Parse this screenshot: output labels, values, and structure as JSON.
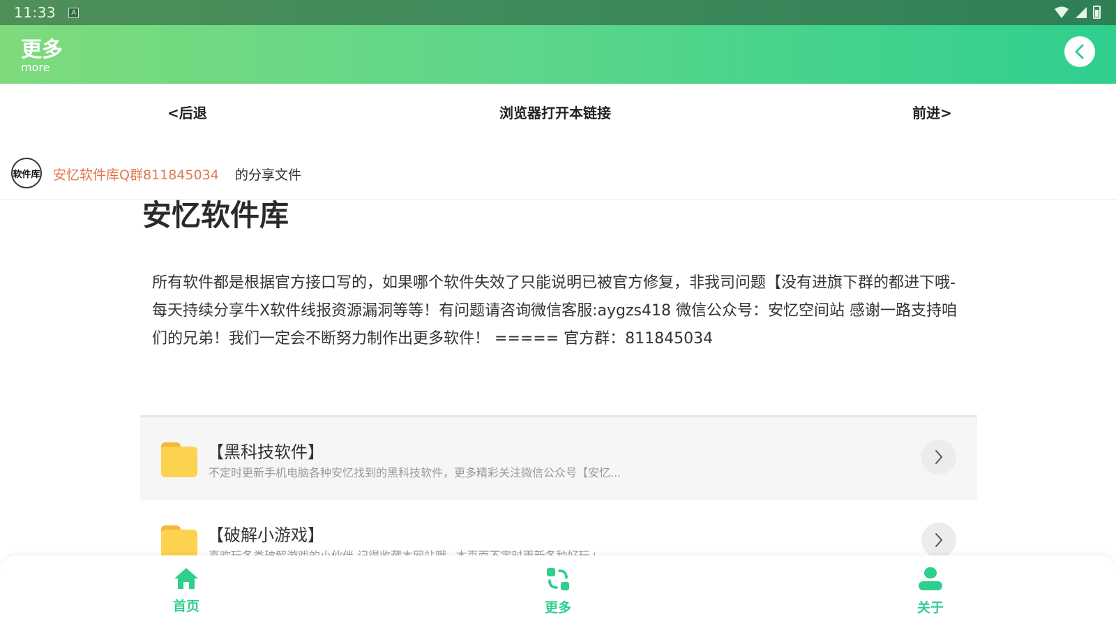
{
  "status_bar": {
    "time": "11:33",
    "keyboard_badge": "A"
  },
  "header": {
    "title": "更多",
    "subtitle": "more"
  },
  "nav": {
    "back": "<后退",
    "open_in_browser": "浏览器打开本链接",
    "forward": "前进>"
  },
  "share": {
    "avatar_text": "软件库",
    "name": "安忆软件库Q群811845034",
    "suffix": "的分享文件"
  },
  "content": {
    "title": "安忆软件库",
    "description": "所有软件都是根据官方接口写的，如果哪个软件失效了只能说明已被官方修复，非我司问题【没有进旗下群的都进下哦-每天持续分享牛X软件线报资源漏洞等等！有问题请咨询微信客服:aygzs418 微信公众号：安忆空间站 感谢一路支持咱们的兄弟！我们一定会不断努力制作出更多软件！ ===== 官方群：811845034"
  },
  "list": [
    {
      "title": "【黑科技软件】",
      "subtitle": "不定时更新手机电脑各种安忆找到的黑科技软件，更多精彩关注微信公众号【安忆..."
    },
    {
      "title": "【破解小游戏】",
      "subtitle": "喜欢玩各类破解游戏的小伙伴 记得收藏本网站哦~本页面不定时更新各种好玩+..."
    }
  ],
  "bottom_nav": {
    "home": "首页",
    "more": "更多",
    "about": "关于"
  },
  "colors": {
    "accent": "#2fcf8e",
    "header_start": "#7edb7c",
    "link_orange": "#e0764a",
    "folder": "#fdd24f"
  }
}
